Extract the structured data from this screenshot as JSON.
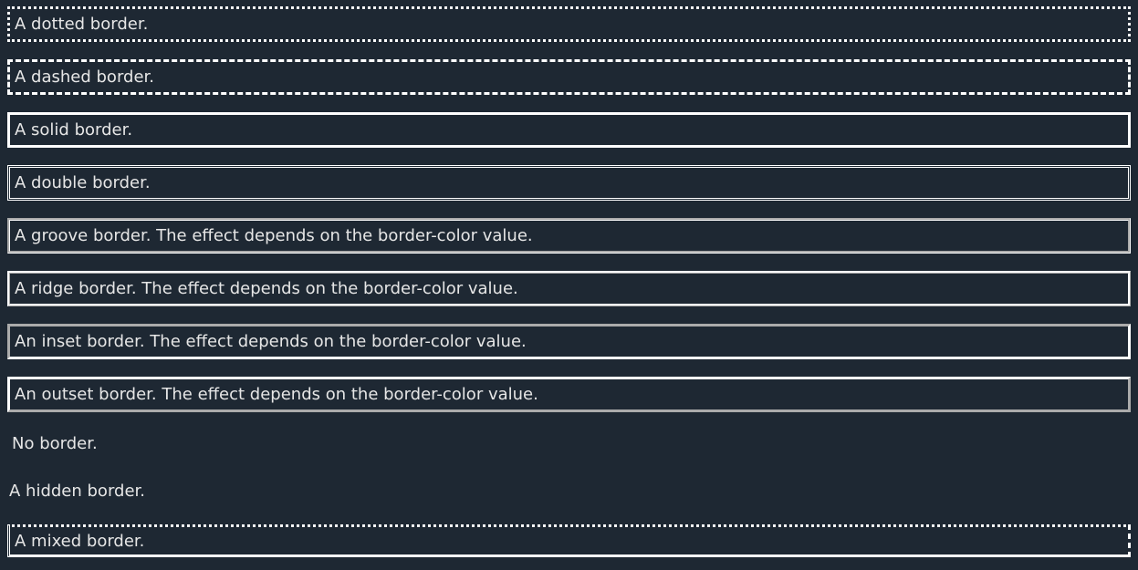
{
  "paragraphs": {
    "dotted": "A dotted border.",
    "dashed": "A dashed border.",
    "solid": "A solid border.",
    "double": "A double border.",
    "groove": "A groove border. The effect depends on the border-color value.",
    "ridge": "A ridge border. The effect depends on the border-color value.",
    "inset": "An inset border. The effect depends on the border-color value.",
    "outset": "An outset border. The effect depends on the border-color value.",
    "none": "No border.",
    "hidden": "A hidden border.",
    "mixed": "A mixed border."
  },
  "colors": {
    "background": "#1e2833",
    "text": "#e6e6e6",
    "border": "#ffffff"
  }
}
